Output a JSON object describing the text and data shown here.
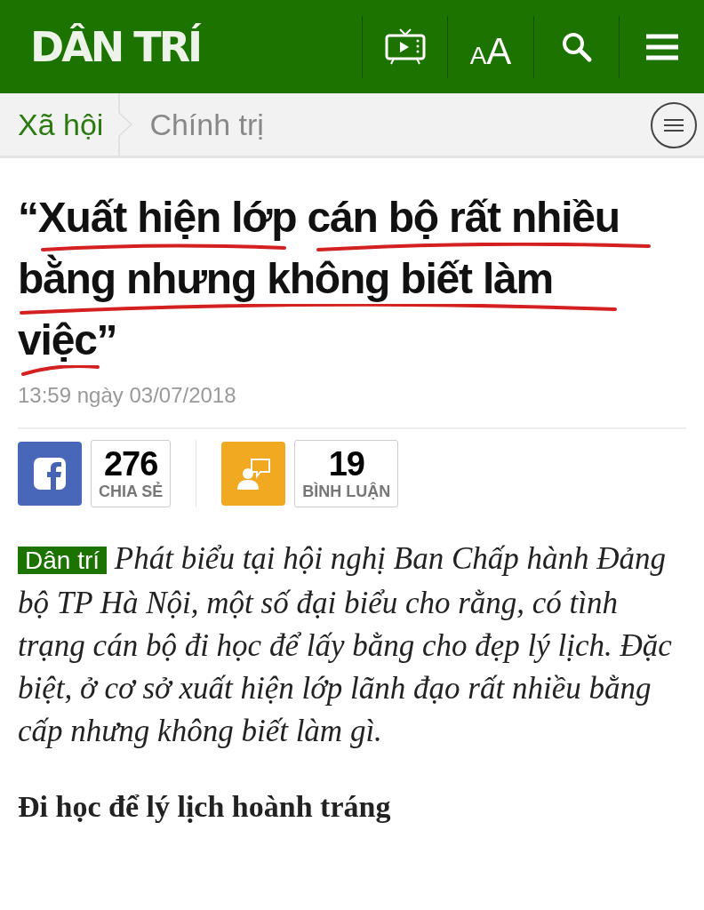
{
  "header": {
    "logo": "DÂN TRÍ",
    "font_button": {
      "small": "A",
      "large": "A"
    }
  },
  "breadcrumb": [
    {
      "label": "Xã hội",
      "selected": true
    },
    {
      "label": "Chính trị",
      "selected": false
    }
  ],
  "article": {
    "title_lines": [
      "“Xuất hiện lớp cán bộ rất nhiều",
      "bằng nhưng không biết làm",
      "việc”"
    ],
    "time": "13:59 ngày 03/07/2018",
    "share": {
      "count": "276",
      "label": "CHIA SẺ"
    },
    "comments": {
      "count": "19",
      "label": "BÌNH LUẬN"
    },
    "source_tag": "Dân trí",
    "lead": "Phát biểu tại hội nghị Ban Chấp hành Đảng bộ TP Hà Nội, một số đại biểu cho rằng, có tình trạng cán bộ đi học để lấy bằng cho đẹp lý lịch. Đặc biệt, ở cơ sở xuất hiện lớp lãnh đạo rất nhiều bằng cấp nhưng không biết làm gì.",
    "subheading": "Đi học để lý lịch hoành tráng"
  }
}
